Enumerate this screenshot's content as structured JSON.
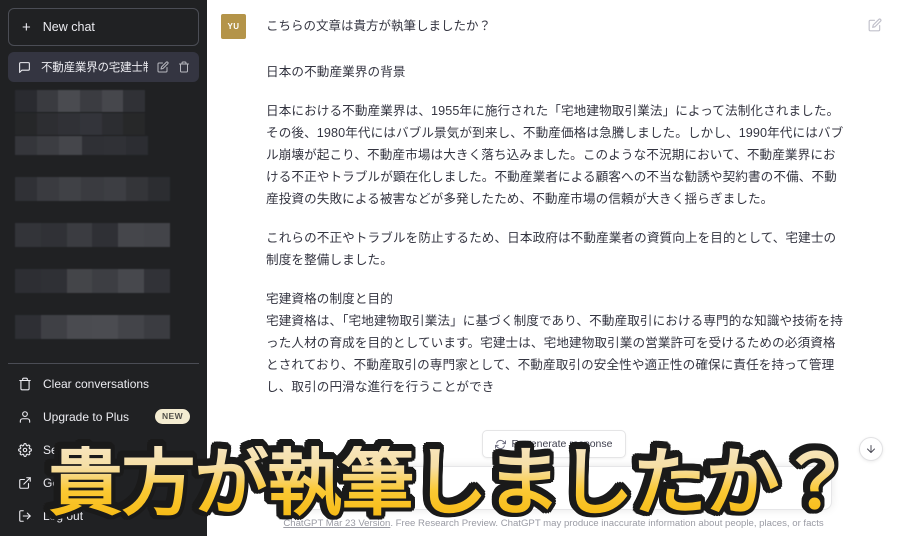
{
  "sidebar": {
    "new_chat_label": "New chat",
    "new_chat_icon": "plus-icon",
    "active_chat": {
      "title": "不動産業界の宅建士制",
      "icon": "chat-bubble-icon",
      "edit_icon": "pencil-icon",
      "delete_icon": "trash-icon"
    },
    "hidden_chats_count": 5,
    "menu": [
      {
        "label": "Clear conversations",
        "icon": "trash-icon",
        "badge": ""
      },
      {
        "label": "Upgrade to Plus",
        "icon": "user-icon",
        "badge": "NEW"
      },
      {
        "label": "Settings",
        "icon": "gear-icon",
        "badge": ""
      },
      {
        "label": "Get help",
        "icon": "external-link-icon",
        "badge": ""
      },
      {
        "label": "Log out",
        "icon": "logout-icon",
        "badge": ""
      }
    ]
  },
  "conversation": {
    "user_message": {
      "avatar_initials": "YU",
      "text": "こちらの文章は貴方が執筆しましたか？",
      "edit_icon": "pencil-square-icon"
    },
    "assistant_message": {
      "paragraphs": [
        "日本の不動産業界の背景",
        "日本における不動産業界は、1955年に施行された「宅地建物取引業法」によって法制化されました。その後、1980年代にはバブル景気が到来し、不動産価格は急騰しました。しかし、1990年代にはバブル崩壊が起こり、不動産市場は大きく落ち込みました。このような不況期において、不動産業界における不正やトラブルが顕在化しました。不動産業者による顧客への不当な勧誘や契約書の不備、不動産投資の失敗による被害などが多発したため、不動産市場の信頼が大きく揺らぎました。",
        "これらの不正やトラブルを防止するため、日本政府は不動産業者の資質向上を目的として、宅建士の制度を整備しました。",
        "宅建資格の制度と目的\n宅建資格は、「宅地建物取引業法」に基づく制度であり、不動産取引における専門的な知識や技術を持った人材の育成を目的としています。宅建士は、宅地建物取引業の営業許可を受けるための必須資格とされており、不動産取引の専門家として、不動産取引の安全性や適正性の確保に責任を持って管理し、取引の円滑な進行を行うことができ"
      ]
    }
  },
  "regenerate": {
    "label": "Regenerate response",
    "icon": "refresh-icon"
  },
  "composer": {
    "value": "",
    "placeholder": "",
    "send_icon": "send-icon"
  },
  "scroll_button": {
    "icon": "arrow-down-icon"
  },
  "footer": {
    "link_text": "ChatGPT Mar 23 Version",
    "rest_text": ". Free Research Preview. ChatGPT may produce inaccurate information about people, places, or facts"
  },
  "overlay": {
    "text": "貴方が執筆しましたか？",
    "fill_top_color": "#f7e5bd",
    "fill_bottom_color": "#f5b912",
    "stroke_color": "#1a1a1a"
  },
  "colors": {
    "sidebar_bg": "#202123",
    "sidebar_active": "#343541",
    "avatar_bg": "#b49449",
    "badge_bg": "#f4ecd1",
    "main_bg": "#ffffff",
    "text_primary": "#343541"
  }
}
